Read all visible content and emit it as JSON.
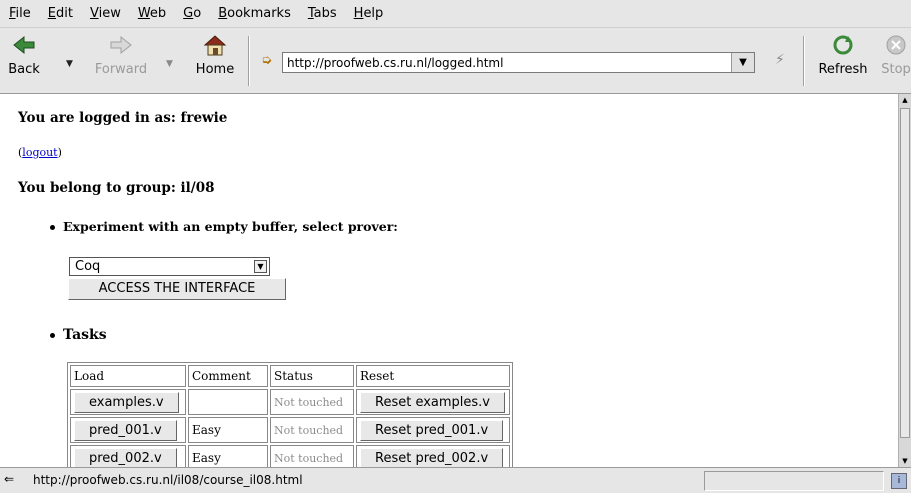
{
  "menu": [
    "File",
    "Edit",
    "View",
    "Web",
    "Go",
    "Bookmarks",
    "Tabs",
    "Help"
  ],
  "menu_accel": [
    "F",
    "E",
    "V",
    "W",
    "G",
    "B",
    "T",
    "H"
  ],
  "menu_rest": [
    "ile",
    "dit",
    "iew",
    "eb",
    "o",
    "ookmarks",
    "abs",
    "elp"
  ],
  "toolbar": {
    "back_label": "Back",
    "forward_label": "Forward",
    "home_label": "Home",
    "refresh_label": "Refresh",
    "stop_label": "Stop",
    "url": "http://proofweb.cs.ru.nl/logged.html"
  },
  "page": {
    "logged_in_text": "You are logged in as: frewie",
    "logout_open": "(",
    "logout_link": "logout",
    "logout_close": ")",
    "group_text": "You belong to group: il/08",
    "experiment_text": "Experiment with an empty buffer, select prover:",
    "prover_selected": "Coq",
    "access_button": "ACCESS THE INTERFACE",
    "tasks_heading": "Tasks",
    "table": {
      "headers": [
        "Load",
        "Comment",
        "Status",
        "Reset"
      ],
      "rows": [
        {
          "load": "examples.v",
          "comment": "",
          "status": "Not touched",
          "reset": "Reset examples.v"
        },
        {
          "load": "pred_001.v",
          "comment": "Easy",
          "status": "Not touched",
          "reset": "Reset pred_001.v"
        },
        {
          "load": "pred_002.v",
          "comment": "Easy",
          "status": "Not touched",
          "reset": "Reset pred_002.v"
        }
      ]
    }
  },
  "statusbar": {
    "text": "http://proofweb.cs.ru.nl/il08/course_il08.html"
  }
}
